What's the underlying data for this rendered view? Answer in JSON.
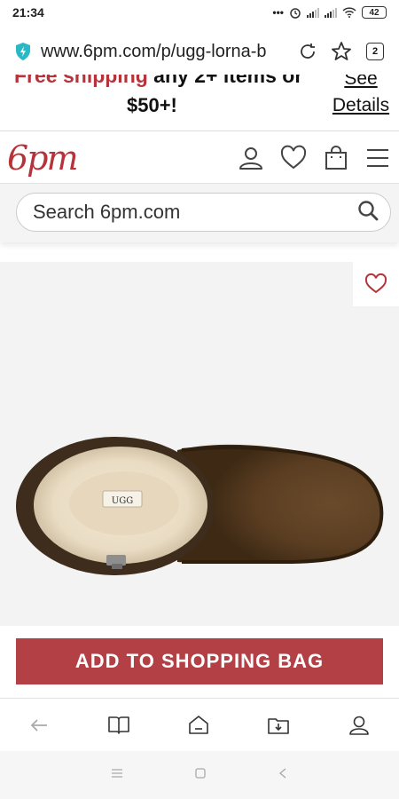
{
  "status_bar": {
    "time": "21:34",
    "dots": "•••",
    "battery": "42"
  },
  "browser": {
    "url": "www.6pm.com/p/ugg-lorna-b",
    "tab_count": "2"
  },
  "promo": {
    "line1_red": "Free shipping",
    "line1_rest": " any 2+ items or",
    "line2": "$50+!",
    "see_details": "See Details"
  },
  "header": {
    "logo": "6pm"
  },
  "search": {
    "placeholder": "Search 6pm.com"
  },
  "product": {
    "brand_mark": "UGG"
  },
  "cta": {
    "add_to_bag": "ADD TO SHOPPING BAG"
  },
  "colors": {
    "brand_red": "#b5343b",
    "cta_red": "#b34045"
  }
}
